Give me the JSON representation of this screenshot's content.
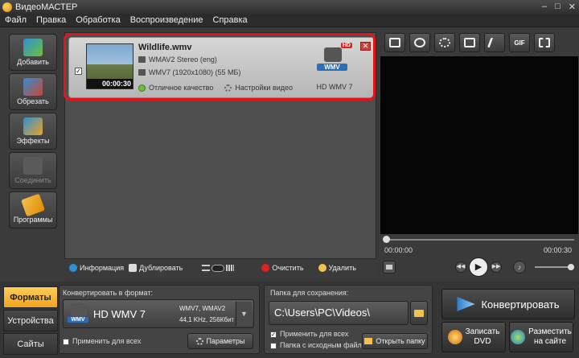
{
  "window": {
    "title": "ВидеоМАСТЕР",
    "controls": [
      "–",
      "□",
      "✕"
    ]
  },
  "menu": [
    "Файл",
    "Правка",
    "Обработка",
    "Воспроизведение",
    "Справка"
  ],
  "sidebar": {
    "items": [
      {
        "label": "Добавить",
        "icon": "film-add-icon",
        "enabled": true,
        "color": "#2e8fd6"
      },
      {
        "label": "Обрезать",
        "icon": "film-scissors-icon",
        "enabled": true,
        "color": "#2e8fd6"
      },
      {
        "label": "Эффекты",
        "icon": "film-effects-icon",
        "enabled": true,
        "color": "#e9a324"
      },
      {
        "label": "Соединить",
        "icon": "film-join-icon",
        "enabled": false,
        "color": "#666666"
      },
      {
        "label": "Программы",
        "icon": "programs-icon",
        "enabled": true,
        "color": "#f2c14e"
      }
    ]
  },
  "file": {
    "checked": true,
    "name": "Wildlife.wmv",
    "duration": "00:00:30",
    "audio": "WMAV2 Stereo (eng)",
    "video": "WMV7 (1920x1080) (55 МБ)",
    "quality": "Отличное качество",
    "settings": "Настройки видео",
    "format_label": "HD WMV 7",
    "format_tag": "WMV",
    "hd_badge": "HD"
  },
  "filetools": {
    "info": "Информация",
    "duplicate": "Дублировать",
    "clear": "Очистить",
    "delete": "Удалить"
  },
  "righttools": [
    {
      "icon": "crop-icon"
    },
    {
      "icon": "stabilize-icon"
    },
    {
      "icon": "brightness-icon"
    },
    {
      "icon": "rotate-icon"
    },
    {
      "icon": "speed-icon"
    },
    {
      "icon": "gif-icon",
      "text": "GIF"
    },
    {
      "icon": "fullscreen-icon"
    }
  ],
  "player": {
    "time_start": "00:00:00",
    "time_end": "00:00:30",
    "progress": 0,
    "volume": 1.0
  },
  "tabs": {
    "formats": "Форматы",
    "devices": "Устройства",
    "sites": "Сайты"
  },
  "convert_format": {
    "label": "Конвертировать в формат:",
    "name": "HD WMV 7",
    "detail1": "WMV7, WMAV2",
    "detail2": "44,1 KHz, 256Кбит",
    "apply_all": "Применить для всех",
    "params": "Параметры",
    "tag": "WMV"
  },
  "save": {
    "label": "Папка для сохранения:",
    "path": "C:\\Users\\PC\\Videos\\",
    "apply_all": "Применить для всех",
    "apply_all_checked": true,
    "source_folder": "Папка с исходным файлом",
    "open_folder": "Открыть папку"
  },
  "actions": {
    "convert": "Конвертировать",
    "dvd_line1": "Записать",
    "dvd_line2": "DVD",
    "web_line1": "Разместить",
    "web_line2": "на сайте"
  },
  "colors": {
    "accent": "#f0a21f",
    "highlight": "#e3141c",
    "wmv": "#2c6fb7"
  }
}
